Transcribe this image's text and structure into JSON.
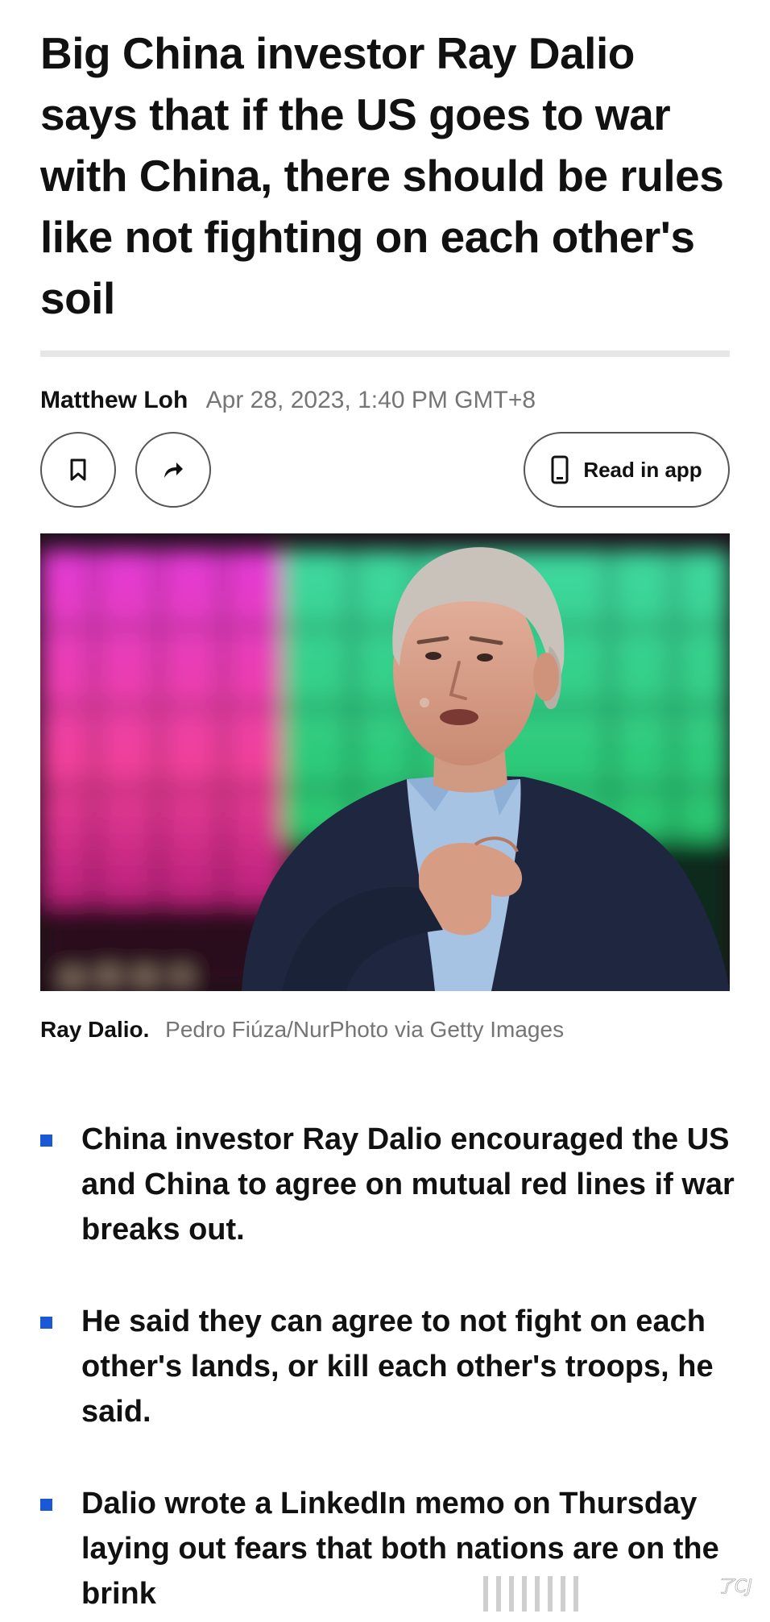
{
  "article": {
    "headline": "Big China investor Ray Dalio says that if the US goes to war with China, there should be rules like not fighting on each other's soil",
    "author": "Matthew Loh",
    "date": "Apr 28, 2023, 1:40 PM GMT+8"
  },
  "actions": {
    "bookmark_icon": "bookmark-icon",
    "share_icon": "share-arrow-icon",
    "read_in_app_icon": "phone-icon",
    "read_in_app_label": "Read in app"
  },
  "image": {
    "caption_name": "Ray Dalio.",
    "caption_credit": "Pedro Fiúza/NurPhoto via Getty Images"
  },
  "key_points": [
    "China investor Ray Dalio encouraged the US and China to agree on mutual red lines if war breaks out.",
    "He said they can agree to not fight on each other's lands, or kill each other's troops, he said.",
    "Dalio wrote a LinkedIn memo on Thursday laying out fears that both nations are on the brink"
  ],
  "colors": {
    "bullet_accent": "#1b58d6",
    "text": "#111111",
    "muted_text": "#757575"
  }
}
